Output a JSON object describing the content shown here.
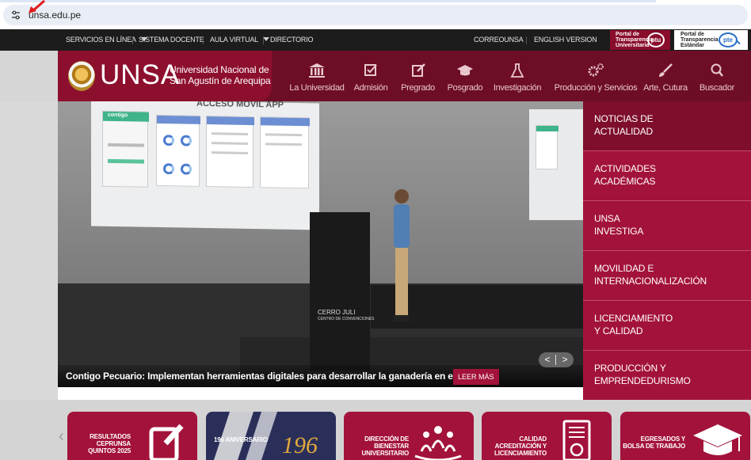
{
  "browser": {
    "url": "unsa.edu.pe",
    "tune_icon": "tune-icon"
  },
  "topbar": {
    "items": [
      {
        "label": "SERVICIOS EN LÍNEA",
        "dropdown": true
      },
      {
        "label": "SISTEMA DOCENTE",
        "dropdown": false
      },
      {
        "label": "AULA VIRTUAL",
        "dropdown": true
      },
      {
        "label": "DIRECTORIO",
        "dropdown": false
      },
      {
        "label": "CORREOUNSA",
        "dropdown": false
      },
      {
        "label": "ENGLISH VERSION",
        "dropdown": false
      }
    ],
    "ptu": {
      "line1": "Portal de",
      "line2": "Transparencia",
      "line3": "Universitaria",
      "logo": "ptu"
    },
    "pte": {
      "line1": "Portal de",
      "line2": "Transparencia",
      "line3": "Estándar",
      "logo": "pte"
    }
  },
  "header": {
    "brand": "UNSA",
    "uni_line1": "Universidad Nacional de",
    "uni_line2": "San Agustín de Arequipa",
    "nav": [
      {
        "label": "La Universidad",
        "icon": "building-icon"
      },
      {
        "label": "Admisión",
        "icon": "checkbox-icon"
      },
      {
        "label": "Pregrado",
        "icon": "edit-icon"
      },
      {
        "label": "Posgrado",
        "icon": "graduation-cap-icon"
      },
      {
        "label": "Investigación",
        "icon": "flask-icon"
      },
      {
        "label": "Producción y Servicios",
        "icon": "gears-icon"
      },
      {
        "label": "Arte, Cutura",
        "icon": "brush-icon"
      },
      {
        "label": "Buscador",
        "icon": "search-icon"
      }
    ]
  },
  "hero": {
    "app_title": "ACCESO MÓVIL APP",
    "app_brand": "contigo",
    "banner_l1": "CERRO JULI",
    "banner_l2": "CENTRO DE CONVENCIONES",
    "caption": "Contigo Pecuario: Implementan herramientas digitales para desarrollar la ganadería en el Perú",
    "read_more": "LEER MÁS",
    "prev": "<",
    "next": ">"
  },
  "side_menu": [
    {
      "line1": "NOTICIAS DE",
      "line2": "ACTUALIDAD",
      "active": true
    },
    {
      "line1": "ACTIVIDADES",
      "line2": "ACADÉMICAS",
      "active": false
    },
    {
      "line1": "UNSA",
      "line2": "INVESTIGA",
      "active": false
    },
    {
      "line1": "MOVILIDAD E",
      "line2": "INTERNACIONALIZACIÓN",
      "active": false
    },
    {
      "line1": "LICENCIAMIENTO",
      "line2": "Y CALIDAD",
      "active": false
    },
    {
      "line1": "PRODUCCIÓN Y",
      "line2": "EMPRENDEDURISMO",
      "active": false
    }
  ],
  "cards": [
    {
      "l1": "RESULTADOS",
      "l2": "CEPRUNSA",
      "l3": "QUINTOS 2025",
      "icon": "edit-icon",
      "color": "#a3123a"
    },
    {
      "l1": "196 ANIVERSARIO",
      "l2": "",
      "l3": "",
      "badge": "196",
      "icon": "anniversary-icon",
      "color": "#2a2f5a"
    },
    {
      "l1": "DIRECCIÓN DE",
      "l2": "BIENESTAR",
      "l3": "UNIVERSITARIO",
      "icon": "people-icon",
      "color": "#a3123a"
    },
    {
      "l1": "CALIDAD",
      "l2": "ACREDITACIÓN Y",
      "l3": "LICENCIAMIENTO",
      "icon": "certificate-icon",
      "color": "#a3123a"
    },
    {
      "l1": "EGRESADOS Y",
      "l2": "BOLSA DE TRABAJO",
      "l3": "",
      "icon": "graduation-cap-icon",
      "color": "#a3123a"
    }
  ],
  "carousel": {
    "prev": "‹",
    "next": "›"
  }
}
